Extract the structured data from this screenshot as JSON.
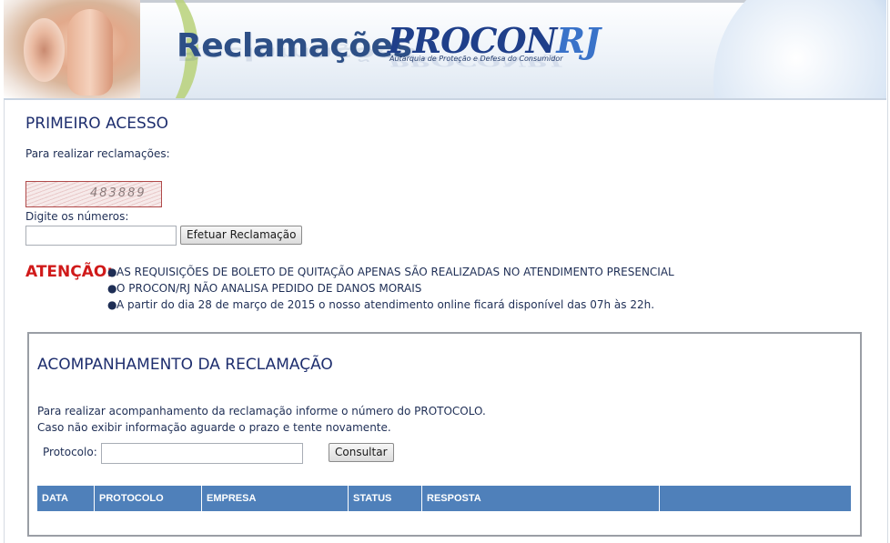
{
  "header": {
    "title": "Reclamações",
    "logo_text": "PROCON",
    "logo_suffix": "RJ",
    "logo_subtitle": "Autarquia de Proteção e Defesa do Consumidor"
  },
  "primeiro_acesso": {
    "heading": "PRIMEIRO ACESSO",
    "intro": "Para realizar reclamações:",
    "captcha_text": "483889",
    "digits_label": "Digite os números:",
    "digits_value": "",
    "submit_label": "Efetuar Reclamação"
  },
  "atencao": {
    "label": "ATENÇÃO:",
    "bullet": "●",
    "items": [
      "AS REQUISIÇÕES DE BOLETO DE QUITAÇÃO APENAS SÃO REALIZADAS NO ATENDIMENTO PRESENCIAL",
      "O PROCON/RJ NÃO ANALISA PEDIDO DE DANOS MORAIS",
      "A partir do dia 28 de março de 2015 o nosso atendimento online ficará disponível das 07h às 22h."
    ]
  },
  "acompanhamento": {
    "heading": "ACOMPANHAMENTO DA RECLAMAÇÃO",
    "line1_prefix": "Para realizar acompanhamento da reclamação informe o número do",
    "line1_emph": "PROTOCOLO.",
    "line2": "Caso não exibir informação aguarde o prazo e tente novamente.",
    "protocolo_label": "Protocolo:",
    "protocolo_value": "",
    "consultar_label": "Consultar",
    "columns": [
      "DATA",
      "PROTOCOLO",
      "EMPRESA",
      "STATUS",
      "RESPOSTA",
      ""
    ]
  },
  "colors": {
    "heading": "#1e2e6e",
    "alert": "#d01a1a",
    "table_header": "#4f80ba"
  }
}
